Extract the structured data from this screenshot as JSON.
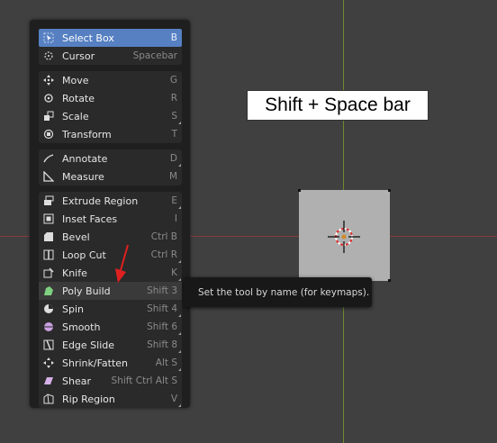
{
  "caption": "Shift + Space bar",
  "tooltip": "Set the tool by name (for keymaps).",
  "colors": {
    "active": "#5680c2",
    "axis_x": "#8a3a3a",
    "axis_y": "#6e8a2e",
    "arrow": "#e02020"
  },
  "menu": {
    "groups": [
      {
        "items": [
          {
            "label": "Select Box",
            "shortcut": "B",
            "icon": "select-box-icon",
            "active": true
          },
          {
            "label": "Cursor",
            "shortcut": "Spacebar",
            "icon": "cursor-icon"
          }
        ]
      },
      {
        "items": [
          {
            "label": "Move",
            "shortcut": "G",
            "icon": "move-icon"
          },
          {
            "label": "Rotate",
            "shortcut": "R",
            "icon": "rotate-icon"
          },
          {
            "label": "Scale",
            "shortcut": "S",
            "icon": "scale-icon",
            "more": true
          },
          {
            "label": "Transform",
            "shortcut": "T",
            "icon": "transform-icon"
          }
        ]
      },
      {
        "items": [
          {
            "label": "Annotate",
            "shortcut": "D",
            "icon": "annotate-icon",
            "more": true
          },
          {
            "label": "Measure",
            "shortcut": "M",
            "icon": "measure-icon"
          }
        ]
      },
      {
        "items": [
          {
            "label": "Extrude Region",
            "shortcut": "E",
            "icon": "extrude-region-icon",
            "more": true
          },
          {
            "label": "Inset Faces",
            "shortcut": "I",
            "icon": "inset-faces-icon"
          },
          {
            "label": "Bevel",
            "shortcut": "Ctrl B",
            "icon": "bevel-icon"
          },
          {
            "label": "Loop Cut",
            "shortcut": "Ctrl R",
            "icon": "loop-cut-icon",
            "more": true
          },
          {
            "label": "Knife",
            "shortcut": "K",
            "icon": "knife-icon",
            "more": true
          },
          {
            "label": "Poly Build",
            "shortcut": "Shift 3",
            "icon": "poly-build-icon",
            "hover": true
          },
          {
            "label": "Spin",
            "shortcut": "Shift 4",
            "icon": "spin-icon",
            "more": true
          },
          {
            "label": "Smooth",
            "shortcut": "Shift 6",
            "icon": "smooth-icon",
            "more": true
          },
          {
            "label": "Edge Slide",
            "shortcut": "Shift 8",
            "icon": "edge-slide-icon",
            "more": true
          },
          {
            "label": "Shrink/Fatten",
            "shortcut": "Alt S",
            "icon": "shrink-fatten-icon",
            "more": true
          },
          {
            "label": "Shear",
            "shortcut": "Shift Ctrl Alt S",
            "icon": "shear-icon"
          },
          {
            "label": "Rip Region",
            "shortcut": "V",
            "icon": "rip-region-icon",
            "more": true
          }
        ]
      }
    ]
  }
}
